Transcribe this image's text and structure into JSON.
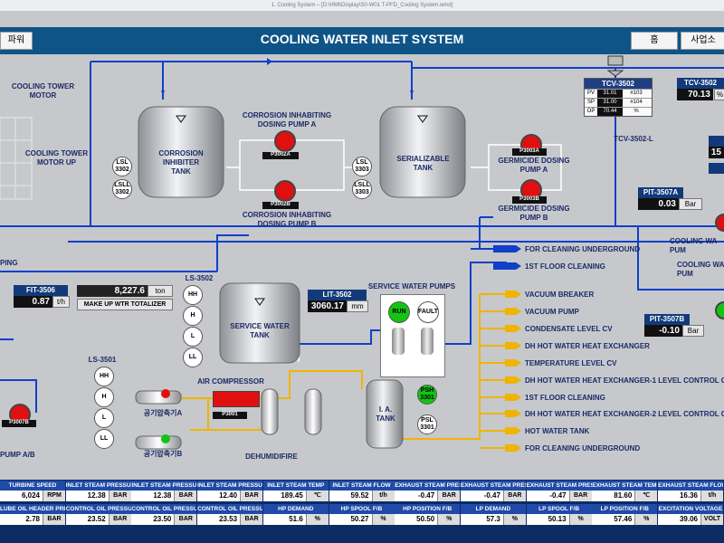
{
  "window_title": "1. Cooling System – [D:\\HMI\\Display\\S0-W01 T-PFD_Cooling System.wmd]",
  "header": {
    "title": "COOLING WATER INLET SYSTEM",
    "left_button": "파워",
    "home_button": "홈",
    "office_button": "사업소"
  },
  "colors": {
    "header": "#0f5487",
    "pipe": "#1040c8",
    "air_line": "#f0b400",
    "pump_red": "#e01010",
    "run_green": "#13c413",
    "bottom_bar": "#0d2c64"
  },
  "diagram": {
    "cooling_tower_motor": "COOLING TOWER\nMOTOR",
    "cooling_tower_motor_up": "COOLING TOWER\nMOTOR UP",
    "corrosion_tank": "CORROSION\nINHIBITER\nTANK",
    "serializable_tank": "SERIALIZABLE\nTANK",
    "pump_a_label": "CORROSION INHABITING\nDOSING PUMP A",
    "pump_b_label": "CORROSION INHABITING\nDOSING PUMP B",
    "germicide_a_label": "GERMICIDE DOSING\nPUMP A",
    "germicide_b_label": "GERMICIDE DOSING\nPUMP B",
    "p3002a": "P3002A",
    "p3002b": "P3002B",
    "p3003a": "P3003A",
    "p3003b": "P3003B",
    "lsl3302": "LSL\n3302",
    "lsll3302": "LSLL\n3302",
    "lsl3303": "LSL\n3303",
    "lsll3303": "LSLL\n3303",
    "tcv_tag": "TCV-3502",
    "tcv_rows": [
      {
        "k": "PV",
        "v": "31.01",
        "s": "#103"
      },
      {
        "k": "SP",
        "v": "31.00",
        "s": "#104"
      },
      {
        "k": "OP",
        "v": "70.44",
        "s": "%"
      }
    ],
    "tcv_l": "TCV-3502-L",
    "tcv2_tag": "TCV-3502",
    "tcv2_value": "70.13",
    "tcv2_unit": "%",
    "right_value_1": "15",
    "pit3507a_tag": "PIT-3507A",
    "pit3507a_value": "0.03",
    "pit3507a_unit": "Bar",
    "pit3507b_tag": "PIT-3507B",
    "pit3507b_value": "-0.10",
    "pit3507b_unit": "Bar",
    "cooling_pump_1": "COOLING WA\nPUM",
    "cooling_pump_2": "COOLING WA\nPUM",
    "piping": "PING",
    "fit_tag": "FIT-3506",
    "fit_value": "0.87",
    "fit_unit": "t/h",
    "totalizer_value": "8,227.6",
    "totalizer_unit": "ton",
    "totalizer_label": "MAKE UP WTR TOTALIZER",
    "ls3502": "LS-3502",
    "ls3502_levels": [
      "HH",
      "H",
      "L",
      "LL"
    ],
    "service_tank": "SERVICE WATER\nTANK",
    "lit_tag": "LIT-3502",
    "lit_value": "3060.17",
    "lit_unit": "mm",
    "service_pumps": "SERVICE WATER PUMPS",
    "run": "RUN",
    "fault": "FAULT",
    "ls3501": "LS-3501",
    "ls3501_levels": [
      "HH",
      "H",
      "L",
      "LL"
    ],
    "p3007b": "P3007B",
    "pump_ab": "PUMP A/B",
    "air_compressor": "AIR COMPRESSOR",
    "p3001": "P3001",
    "comp_a": "공기압축기A",
    "comp_b": "공기압축기B",
    "dehumidifire": "DEHUMIDIFIRE",
    "ia_tank": "I. A.\nTANK",
    "psh": "PSH\n3301",
    "psl": "PSL\n3301",
    "water_dest": [
      "FOR CLEANING UNDERGROUND",
      "1ST FLOOR CLEANING"
    ],
    "air_dest": [
      "VACUUM BREAKER",
      "VACUUM PUMP",
      "CONDENSATE LEVEL CV",
      "DH HOT WATER HEAT EXCHANGER",
      "TEMPERATURE LEVEL CV",
      "DH HOT WATER HEAT EXCHANGER-1 LEVEL CONTROL CV",
      "1ST FLOOR CLEANING",
      "DH HOT WATER HEAT EXCHANGER-2 LEVEL CONTROL CV",
      "HOT WATER TANK",
      "FOR CLEANING UNDERGROUND"
    ]
  },
  "bottom": {
    "row1": [
      {
        "name": "TURBINE SPEED",
        "value": "6,024",
        "unit": "RPM"
      },
      {
        "name": "INLET STEAM PRESSURE-A",
        "value": "12.38",
        "unit": "BAR"
      },
      {
        "name": "INLET STEAM PRESSURE-B",
        "value": "12.38",
        "unit": "BAR"
      },
      {
        "name": "INLET STEAM PRESSURE-C",
        "value": "12.40",
        "unit": "BAR"
      },
      {
        "name": "INLET STEAM TEMP",
        "value": "189.45",
        "unit": "℃"
      },
      {
        "name": "INLET STEAM FLOW",
        "value": "59.52",
        "unit": "t/h"
      },
      {
        "name": "EXHAUST STEAM PRESSURE-A",
        "value": "-0.47",
        "unit": "BAR"
      },
      {
        "name": "EXHAUST STEAM PRESSURE-B",
        "value": "-0.47",
        "unit": "BAR"
      },
      {
        "name": "EXHAUST STEAM PRESSURE-C",
        "value": "-0.47",
        "unit": "BAR"
      },
      {
        "name": "EXHAUST STEAM TEMP",
        "value": "81.60",
        "unit": "℃"
      },
      {
        "name": "EXHAUST STEAM FLOW",
        "value": "16.36",
        "unit": "t/h"
      }
    ],
    "row2": [
      {
        "name": "LUBE OIL HEADER PRESSURE-3",
        "value": "2.78",
        "unit": "BAR"
      },
      {
        "name": "CONTROL OIL PRESSURE-1",
        "value": "23.52",
        "unit": "BAR"
      },
      {
        "name": "CONTROL OIL PRESSURE-2",
        "value": "23.50",
        "unit": "BAR"
      },
      {
        "name": "CONTROL OIL PRESSURE-3",
        "value": "23.53",
        "unit": "BAR"
      },
      {
        "name": "HP DEMAND",
        "value": "51.6",
        "unit": "%"
      },
      {
        "name": "HP SPOOL F/B",
        "value": "50.27",
        "unit": "%"
      },
      {
        "name": "HP POSITION F/B",
        "value": "50.50",
        "unit": "%"
      },
      {
        "name": "LP DEMAND",
        "value": "57.3",
        "unit": "%"
      },
      {
        "name": "LP SPOOL F/B",
        "value": "50.13",
        "unit": "%"
      },
      {
        "name": "LP POSITION F/B",
        "value": "57.46",
        "unit": "%"
      },
      {
        "name": "EXCITATION VOLTAGE",
        "value": "39.06",
        "unit": "VOLT"
      }
    ]
  }
}
